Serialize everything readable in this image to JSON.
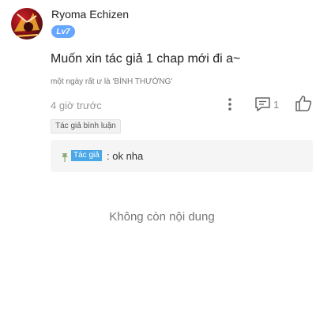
{
  "comment": {
    "username": "Ryoma Echizen",
    "level": "Lv7",
    "text": "Muốn xin tác giả 1 chap mới đi a~",
    "subtext": "một ngày rất ư là 'BÌNH THƯỜNG'",
    "time": "4 giờ trước",
    "reply_count": "1",
    "tag": "Tác giả bình luận"
  },
  "reply": {
    "author_badge": "Tác giả",
    "text": ": ok nha"
  },
  "footer": {
    "end_text": "Không còn nội dung"
  },
  "colors": {
    "level_badge": "#66a6ff",
    "author_badge": "#4aa8e8"
  },
  "icons": [
    "avatar-image",
    "more-vertical-icon",
    "comment-icon",
    "thumbs-up-icon",
    "pin-icon"
  ]
}
